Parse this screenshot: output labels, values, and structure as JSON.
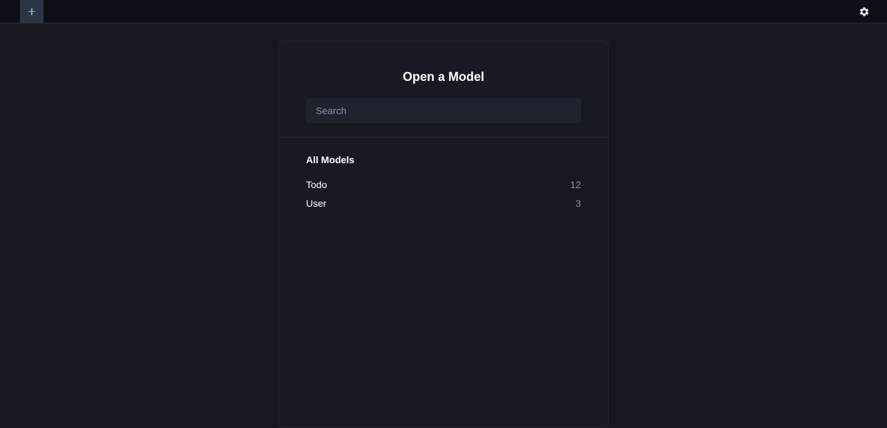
{
  "topbar": {
    "add_tab_icon": "plus-icon",
    "settings_icon": "gear-icon"
  },
  "panel": {
    "title": "Open a Model",
    "search": {
      "placeholder": "Search",
      "value": ""
    },
    "section_title": "All Models",
    "models": [
      {
        "name": "Todo",
        "count": "12"
      },
      {
        "name": "User",
        "count": "3"
      }
    ]
  },
  "colors": {
    "background": "#161821",
    "topbar": "#0e1017",
    "panel": "#171a23",
    "input": "#1f2330",
    "muted_text": "#8c93a3",
    "add_button": "#2d3443"
  }
}
